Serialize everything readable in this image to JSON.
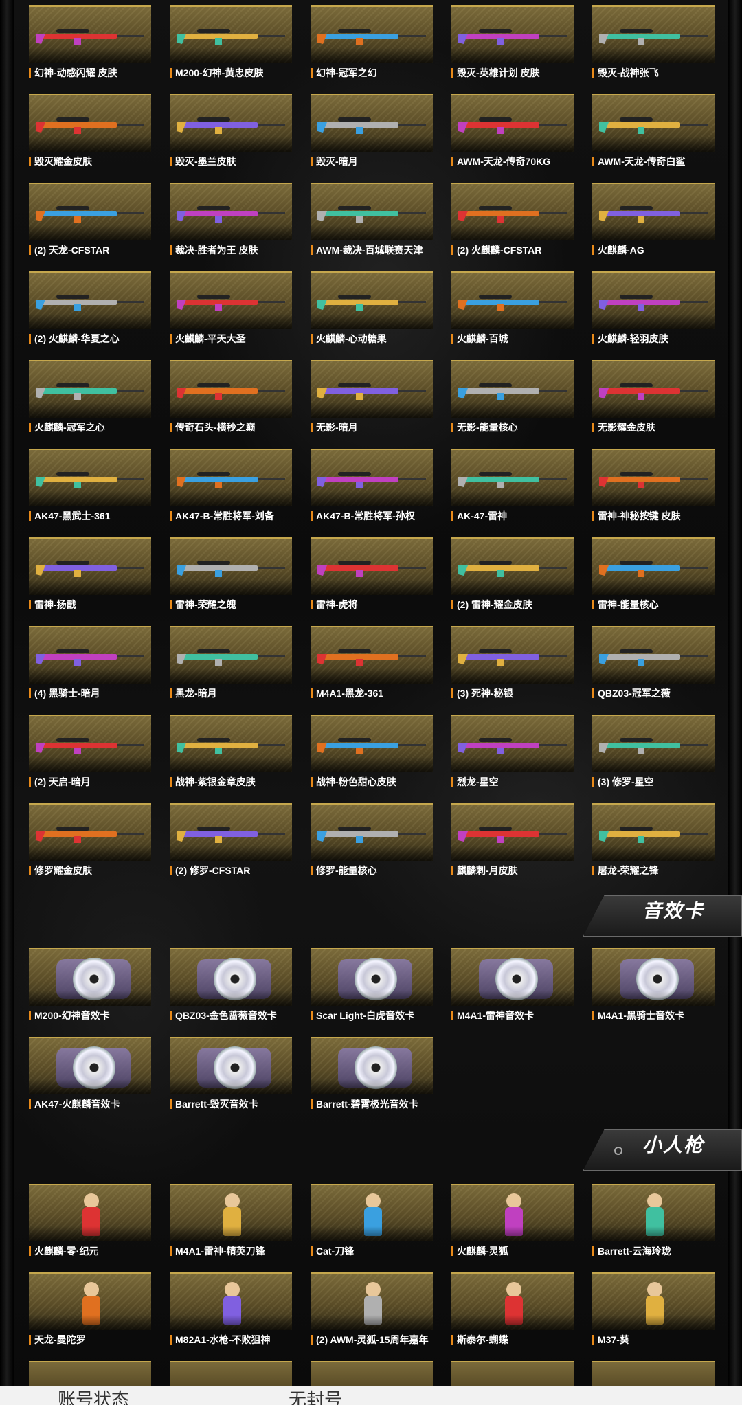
{
  "weapon_skins": [
    "幻神-动感闪耀 皮肤",
    "M200-幻神-黄忠皮肤",
    "幻神-冠军之幻",
    "毁灭-英雄计划 皮肤",
    "毁灭-战神张飞",
    "毁灭耀金皮肤",
    "毁灭-墨兰皮肤",
    "毁灭-暗月",
    "AWM-天龙-传奇70KG",
    "AWM-天龙-传奇白鲨",
    "(2) 天龙-CFSTAR",
    "裁决-胜者为王 皮肤",
    "AWM-裁决-百城联赛天津",
    "(2) 火麒麟-CFSTAR",
    "火麒麟-AG",
    "(2) 火麒麟-华夏之心",
    "火麒麟-平天大圣",
    "火麒麟-心动糖果",
    "火麒麟-百城",
    "火麒麟-轻羽皮肤",
    "火麒麟-冠军之心",
    "传奇石头-横秒之巅",
    "无影-暗月",
    "无影-能量核心",
    "无影耀金皮肤",
    "AK47-黑武士-361",
    "AK47-B-常胜将军-刘备",
    "AK47-B-常胜将军-孙权",
    "AK-47-雷神",
    "雷神-神秘按键 皮肤",
    "雷神-扬戬",
    "雷神-荣耀之魄",
    "雷神-虎将",
    "(2) 雷神-耀金皮肤",
    "雷神-能量核心",
    "(4) 黑骑士-暗月",
    "黑龙-暗月",
    "M4A1-黑龙-361",
    "(3) 死神-秘银",
    "QBZ03-冠军之薇",
    "(2) 天启-暗月",
    "战神-紫银金章皮肤",
    "战神-粉色甜心皮肤",
    "烈龙-星空",
    "(3) 修罗-星空",
    "修罗耀金皮肤",
    "(2) 修罗-CFSTAR",
    "修罗-能量核心",
    "麒麟刺-月皮肤",
    "屠龙-荣耀之锋"
  ],
  "sound_section": {
    "title": "音效卡",
    "items": [
      "M200-幻神音效卡",
      "QBZ03-金色蔷薇音效卡",
      "Scar Light-白虎音效卡",
      "M4A1-雷神音效卡",
      "M4A1-黑骑士音效卡",
      "AK47-火麒麟音效卡",
      "Barrett-毁灭音效卡",
      "Barrett-碧霄极光音效卡"
    ]
  },
  "figure_section": {
    "title": "小人枪",
    "items": [
      "火麒麟-零·纪元",
      "M4A1-雷神-精英刀锋",
      "Cat-刀锋",
      "火麒麟-灵狐",
      "Barrett-云海玲珑",
      "天龙-曼陀罗",
      "M82A1-水枪-不败狙神",
      "(2) AWM-灵狐-15周年嘉年",
      "斯泰尔-蝴蝶",
      "M37-葵"
    ]
  },
  "footer": {
    "left": "账号状态",
    "right": "无封号"
  },
  "colors": {
    "accent": "#e88a1a",
    "card_gold": "#7a6a3a",
    "card_border": "#c5a74d"
  }
}
